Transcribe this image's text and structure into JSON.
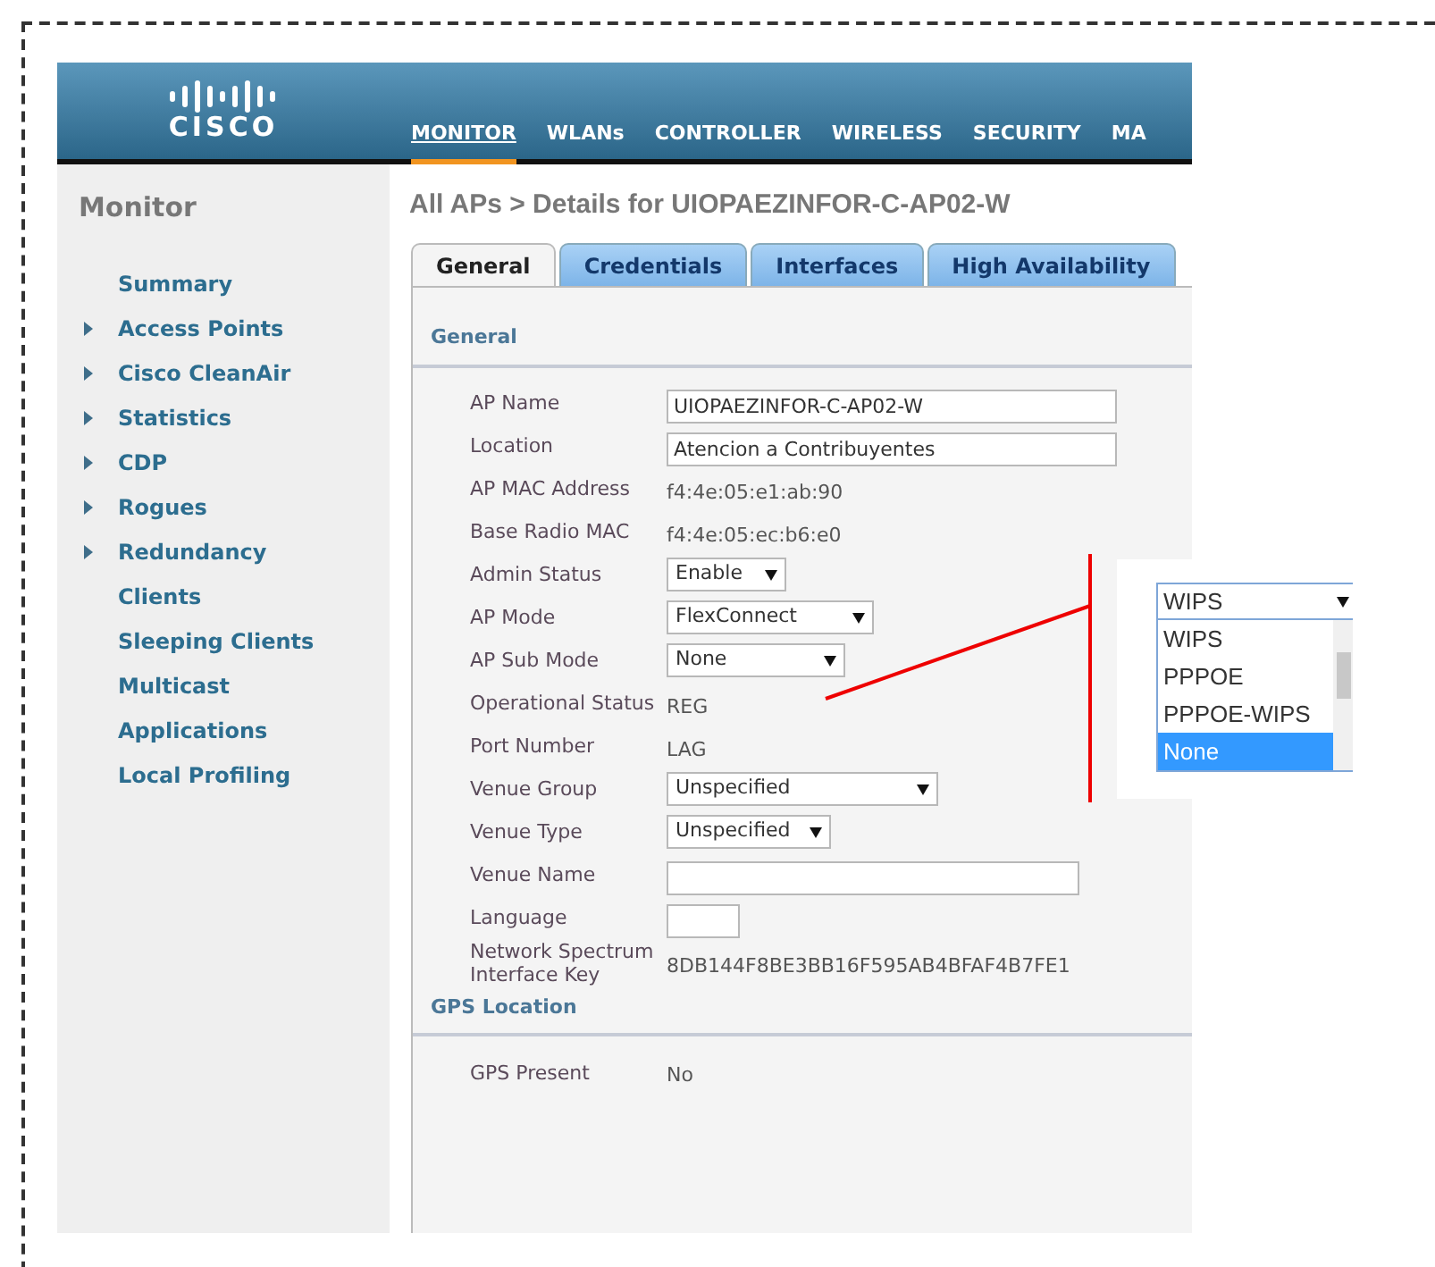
{
  "header": {
    "logo_text": "CISCO",
    "nav": [
      {
        "label": "MONITOR",
        "selected": true
      },
      {
        "label": "WLANs",
        "selected": false
      },
      {
        "label": "CONTROLLER",
        "selected": false
      },
      {
        "label": "WIRELESS",
        "selected": false
      },
      {
        "label": "SECURITY",
        "selected": false
      },
      {
        "label": "MA",
        "selected": false
      }
    ]
  },
  "sidebar": {
    "title": "Monitor",
    "items": [
      {
        "label": "Summary",
        "expandable": false
      },
      {
        "label": "Access Points",
        "expandable": true
      },
      {
        "label": "Cisco CleanAir",
        "expandable": true
      },
      {
        "label": "Statistics",
        "expandable": true
      },
      {
        "label": "CDP",
        "expandable": true
      },
      {
        "label": "Rogues",
        "expandable": true
      },
      {
        "label": "Redundancy",
        "expandable": true
      },
      {
        "label": "Clients",
        "expandable": false
      },
      {
        "label": "Sleeping Clients",
        "expandable": false
      },
      {
        "label": "Multicast",
        "expandable": false
      },
      {
        "label": "Applications",
        "expandable": false
      },
      {
        "label": "Local Profiling",
        "expandable": false
      }
    ]
  },
  "breadcrumb": "All APs > Details for UIOPAEZINFOR-C-AP02-W",
  "tabs": [
    {
      "label": "General",
      "selected": true
    },
    {
      "label": "Credentials",
      "selected": false
    },
    {
      "label": "Interfaces",
      "selected": false
    },
    {
      "label": "High Availability",
      "selected": false
    }
  ],
  "sections": [
    {
      "title": "General",
      "rows": [
        {
          "label": "AP Name",
          "kind": "input",
          "value": "UIOPAEZINFOR-C-AP02-W"
        },
        {
          "label": "Location",
          "kind": "input",
          "value": "Atencion a Contribuyentes"
        },
        {
          "label": "AP MAC Address",
          "kind": "text",
          "value": "f4:4e:05:e1:ab:90"
        },
        {
          "label": "Base Radio MAC",
          "kind": "text",
          "value": "f4:4e:05:ec:b6:e0"
        },
        {
          "label": "Admin Status",
          "kind": "select",
          "value": "Enable"
        },
        {
          "label": "AP Mode",
          "kind": "select",
          "value": "FlexConnect"
        },
        {
          "label": "AP Sub Mode",
          "kind": "select",
          "value": "None"
        },
        {
          "label": "Operational Status",
          "kind": "text",
          "value": "REG"
        },
        {
          "label": "Port Number",
          "kind": "text",
          "value": "LAG"
        },
        {
          "label": "Venue Group",
          "kind": "select",
          "value": "Unspecified"
        },
        {
          "label": "Venue Type",
          "kind": "select",
          "value": "Unspecified"
        },
        {
          "label": "Venue Name",
          "kind": "input"
        },
        {
          "label": "Language",
          "kind": "input"
        },
        {
          "label": "Network Spectrum Interface Key",
          "kind": "text",
          "value": "8DB144F8BE3BB16F595AB4BFAF4B7FE1"
        }
      ]
    },
    {
      "title": "GPS Location",
      "rows": [
        {
          "label": "GPS Present",
          "kind": "text",
          "value": "No"
        }
      ]
    }
  ],
  "callout": {
    "select_value": "WIPS",
    "options": [
      {
        "label": "WIPS",
        "selected": false
      },
      {
        "label": "PPPOE",
        "selected": false
      },
      {
        "label": "PPPOE-WIPS",
        "selected": false
      },
      {
        "label": "None",
        "selected": true
      }
    ]
  }
}
